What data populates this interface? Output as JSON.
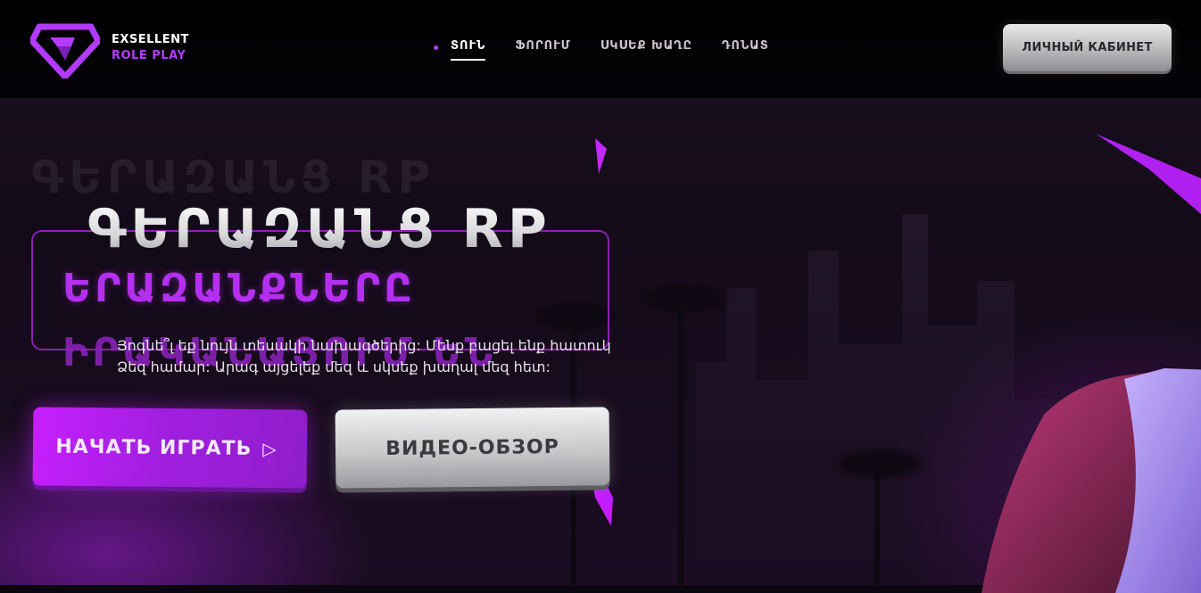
{
  "brand": {
    "line1": "EXSELLENT",
    "line2": "ROLE PLAY",
    "accent_color": "#b23bff"
  },
  "nav": {
    "items": [
      {
        "label": "ՏՈՒՆ",
        "active": true
      },
      {
        "label": "ՖՈՐՈՒՄ",
        "active": false
      },
      {
        "label": "ՍԿՍԵՔ ԽԱՂԸ",
        "active": false
      },
      {
        "label": "ԴՈՆԱՏ",
        "active": false
      }
    ]
  },
  "header": {
    "cabinet_label": "ЛИЧНЫЙ КАБИНЕТ"
  },
  "hero": {
    "ghost_title": "ԳԵՐԱԶԱՆՑ RP",
    "title": "ԳԵՐԱԶԱՆՑ RP",
    "subtitle": "ԵՐԱԶԱՆՔՆԵՐԸ",
    "subtitle2": "ԻՐԱԿԱՆԱՑՈՒՄ ԵՆ",
    "description_line1": "Յոգնե՞լ եք նույն տեսակի նախագծերից: Մենք բացել ենք հատուկ",
    "description_line2": "Ձեզ համար: Արագ այցելեք մեզ և սկսեք խաղալ մեզ հետ:",
    "play_label": "НАЧАТЬ ИГРАТЬ",
    "play_icon": "play-triangle-icon",
    "video_label": "ВИДЕО-ОБЗОР"
  },
  "colors": {
    "primary_purple": "#c81fff",
    "header_bg": "#000000",
    "silver": "#c9c9cc"
  }
}
